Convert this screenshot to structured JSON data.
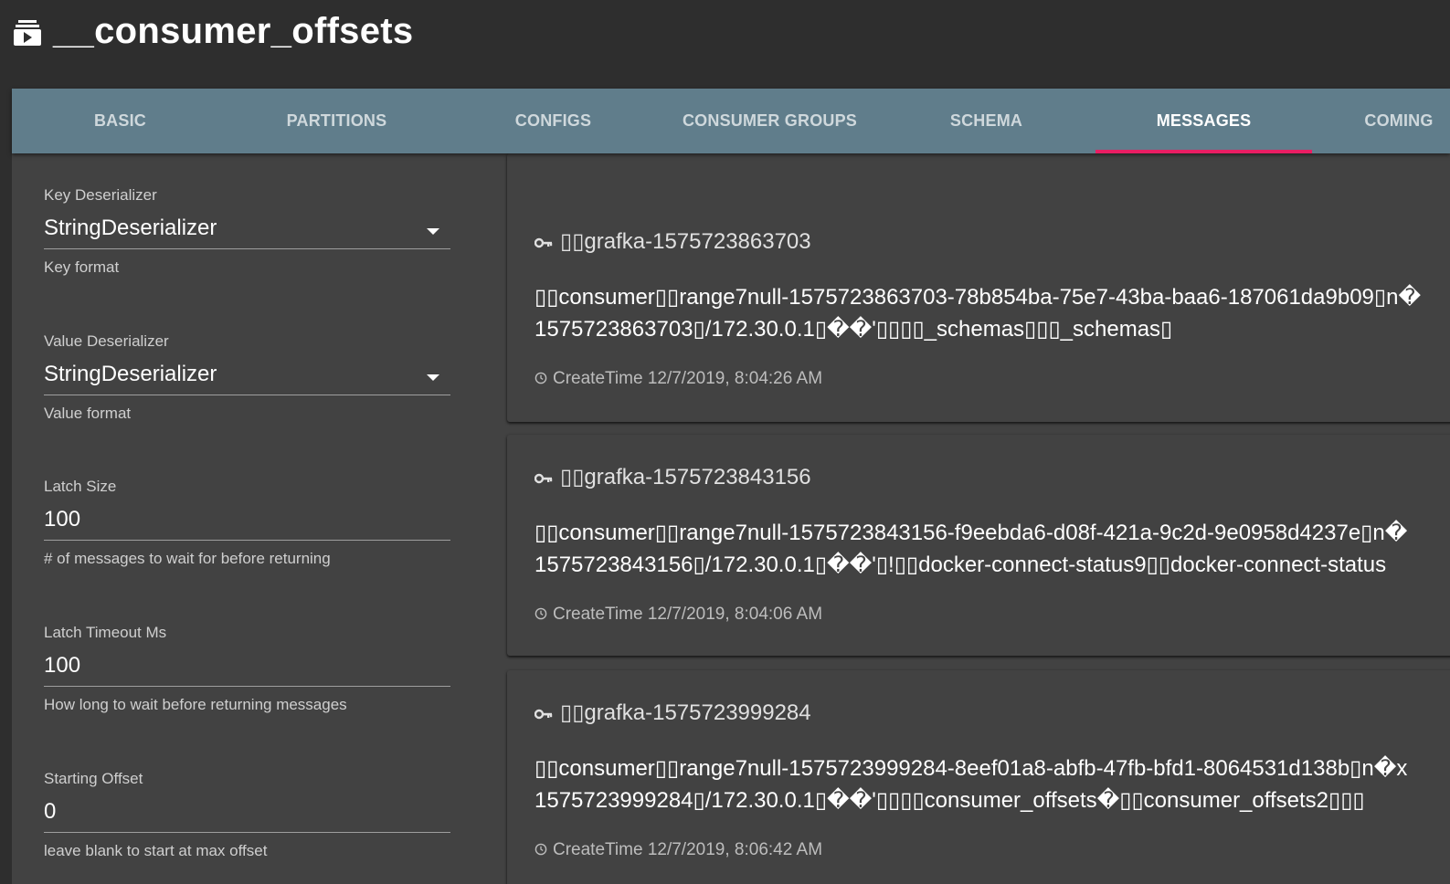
{
  "header": {
    "title": "__consumer_offsets",
    "icon": "topic-icon"
  },
  "tabs": [
    {
      "label": "BASIC",
      "active": false
    },
    {
      "label": "PARTITIONS",
      "active": false
    },
    {
      "label": "CONFIGS",
      "active": false
    },
    {
      "label": "CONSUMER GROUPS",
      "active": false
    },
    {
      "label": "SCHEMA",
      "active": false
    },
    {
      "label": "MESSAGES",
      "active": true
    },
    {
      "label": "COMING",
      "active": false
    }
  ],
  "colors": {
    "tab_bar": "#607d8b",
    "active_indicator": "#e91e63",
    "panel_bg": "#424242",
    "page_bg": "#2e2e2e"
  },
  "sidebar": {
    "key_deserializer": {
      "label": "Key Deserializer",
      "value": "StringDeserializer",
      "help": "Key format"
    },
    "value_deserializer": {
      "label": "Value Deserializer",
      "value": "StringDeserializer",
      "help": "Value format"
    },
    "latch_size": {
      "label": "Latch Size",
      "value": "100",
      "help": "# of messages to wait for before returning"
    },
    "latch_timeout": {
      "label": "Latch Timeout Ms",
      "value": "100",
      "help": "How long to wait before returning messages"
    },
    "starting_offset": {
      "label": "Starting Offset",
      "value": "0",
      "help": "leave blank to start at max offset"
    }
  },
  "messages": [
    {
      "key": "▯▯grafka-1575723863703",
      "line1": "▯▯consumer▯▯range7null-1575723863703-78b854ba-75e7-43ba-baa6-187061da9b09▯n�",
      "line2": "1575723863703▯/172.30.0.1▯��'▯▯▯▯_schemas▯▯▯_schemas▯",
      "time": "CreateTime 12/7/2019, 8:04:26 AM"
    },
    {
      "key": "▯▯grafka-1575723843156",
      "line1": "▯▯consumer▯▯range7null-1575723843156-f9eebda6-d08f-421a-9c2d-9e0958d4237e▯n�",
      "line2": "1575723843156▯/172.30.0.1▯��'▯!▯▯docker-connect-status9▯▯docker-connect-status",
      "time": "CreateTime 12/7/2019, 8:04:06 AM"
    },
    {
      "key": "▯▯grafka-1575723999284",
      "line1": "▯▯consumer▯▯range7null-1575723999284-8eef01a8-abfb-47fb-bfd1-8064531d138b▯n�x",
      "line2": "1575723999284▯/172.30.0.1▯��'▯▯▯▯consumer_offsets�▯▯consumer_offsets2▯▯▯",
      "time": "CreateTime 12/7/2019, 8:06:42 AM"
    }
  ]
}
